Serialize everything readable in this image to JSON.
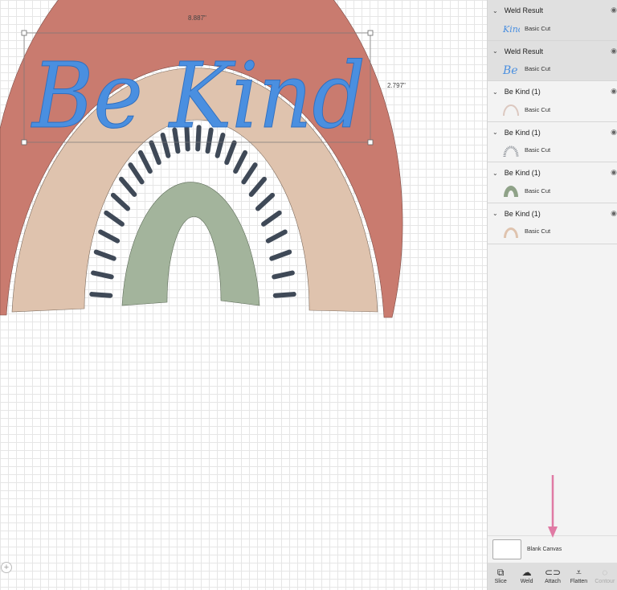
{
  "canvas": {
    "width_label": "8.887\"",
    "height_label": "2.797\"",
    "art_text": "Be Kind"
  },
  "colors": {
    "red": "#c97b6f",
    "tan": "#dfc3ae",
    "navy": "#3f4957",
    "green": "#a3b49c",
    "blue": "#4a8fe0",
    "arrow": "#e07aa4"
  },
  "layers": [
    {
      "title": "Weld Result",
      "op": "Basic Cut",
      "thumb": "kind-text",
      "selected": true
    },
    {
      "title": "Weld Result",
      "op": "Basic Cut",
      "thumb": "be-text",
      "selected": true
    },
    {
      "title": "Be Kind (1)",
      "op": "Basic Cut",
      "thumb": "outer-arc",
      "selected": false
    },
    {
      "title": "Be Kind (1)",
      "op": "Basic Cut",
      "thumb": "rays-arc",
      "selected": false
    },
    {
      "title": "Be Kind (1)",
      "op": "Basic Cut",
      "thumb": "green-arc",
      "selected": false
    },
    {
      "title": "Be Kind (1)",
      "op": "Basic Cut",
      "thumb": "tan-arc",
      "selected": false
    }
  ],
  "thumb_text": {
    "kind": "Kind",
    "be": "Be"
  },
  "blank_canvas": "Blank Canvas",
  "toolbar": [
    {
      "label": "Slice",
      "icon": "slice-icon",
      "glyph": "⧉",
      "enabled": true
    },
    {
      "label": "Weld",
      "icon": "weld-icon",
      "glyph": "☁",
      "enabled": true
    },
    {
      "label": "Attach",
      "icon": "attach-icon",
      "glyph": "⊂⊃",
      "enabled": true
    },
    {
      "label": "Flatten",
      "icon": "flatten-icon",
      "glyph": "⩡",
      "enabled": true
    },
    {
      "label": "Contour",
      "icon": "contour-icon",
      "glyph": "◌",
      "enabled": false
    }
  ],
  "zoom_glyph": "+"
}
